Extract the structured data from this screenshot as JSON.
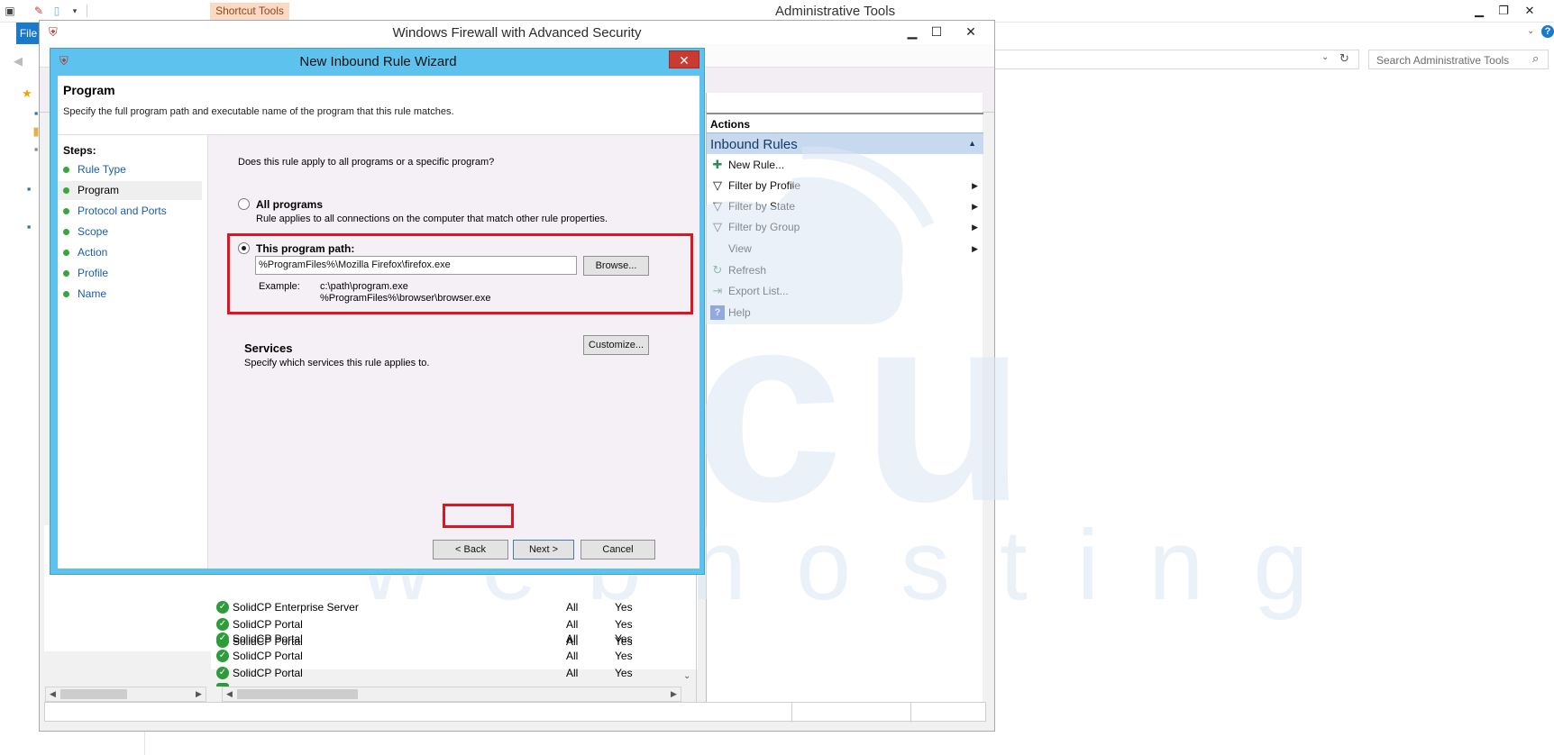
{
  "explorer": {
    "title": "Administrative Tools",
    "contextual_tab": "Shortcut Tools",
    "file_tab": "File",
    "search_placeholder": "Search Administrative Tools"
  },
  "firewall": {
    "title": "Windows Firewall with Advanced Security",
    "actions": {
      "header": "Actions",
      "section": "Inbound Rules",
      "items": [
        {
          "label": "New Rule...",
          "icon": "new-rule-icon",
          "submenu": false
        },
        {
          "label": "Filter by Profile",
          "icon": "filter-icon",
          "submenu": true
        },
        {
          "label": "Filter by State",
          "icon": "filter-icon",
          "submenu": true
        },
        {
          "label": "Filter by Group",
          "icon": "filter-icon",
          "submenu": true
        },
        {
          "label": "View",
          "icon": "",
          "submenu": true
        },
        {
          "label": "Refresh",
          "icon": "refresh-icon",
          "submenu": false
        },
        {
          "label": "Export List...",
          "icon": "export-icon",
          "submenu": false
        },
        {
          "label": "Help",
          "icon": "help-icon",
          "submenu": false
        }
      ]
    },
    "rules": [
      {
        "name": "SolidCP Enterprise Server",
        "profile": "All",
        "enabled": "Yes"
      },
      {
        "name": "SolidCP Portal",
        "profile": "All",
        "enabled": "Yes"
      },
      {
        "name": "SolidCP Portal",
        "profile": "All",
        "enabled": "Yes"
      },
      {
        "name": "SolidCP Portal",
        "profile": "All",
        "enabled": "Yes"
      },
      {
        "name": "SolidCP Portal",
        "profile": "All",
        "enabled": "Yes"
      },
      {
        "name": "SolidCP Portal",
        "profile": "All",
        "enabled": "Yes"
      }
    ]
  },
  "wizard": {
    "title": "New Inbound Rule Wizard",
    "page_title": "Program",
    "page_description": "Specify the full program path and executable name of the program that this rule matches.",
    "steps_label": "Steps:",
    "steps": [
      {
        "label": "Rule Type",
        "current": false
      },
      {
        "label": "Program",
        "current": true
      },
      {
        "label": "Protocol and Ports",
        "current": false
      },
      {
        "label": "Scope",
        "current": false
      },
      {
        "label": "Action",
        "current": false
      },
      {
        "label": "Profile",
        "current": false
      },
      {
        "label": "Name",
        "current": false
      }
    ],
    "question": "Does this rule apply to all programs or a specific program?",
    "all_programs": {
      "label": "All programs",
      "description": "Rule applies to all connections on the computer that match other rule properties.",
      "selected": false
    },
    "program_path": {
      "label": "This program path:",
      "value": "%ProgramFiles%\\Mozilla Firefox\\firefox.exe",
      "selected": true,
      "browse": "Browse...",
      "example_label": "Example:",
      "example_line1": "c:\\path\\program.exe",
      "example_line2": "%ProgramFiles%\\browser\\browser.exe"
    },
    "services": {
      "label": "Services",
      "description": "Specify which services this rule applies to.",
      "customize": "Customize..."
    },
    "buttons": {
      "back": "< Back",
      "next": "Next >",
      "cancel": "Cancel"
    }
  },
  "watermark": {
    "word": "accu",
    "sub": "webhosting",
    "color": "#dbe7f3"
  },
  "colors": {
    "wizard_frame": "#5ec2ee",
    "highlight": "#e0141f",
    "inbound_header": "#c7d9ef",
    "file_tab": "#1979ca"
  }
}
